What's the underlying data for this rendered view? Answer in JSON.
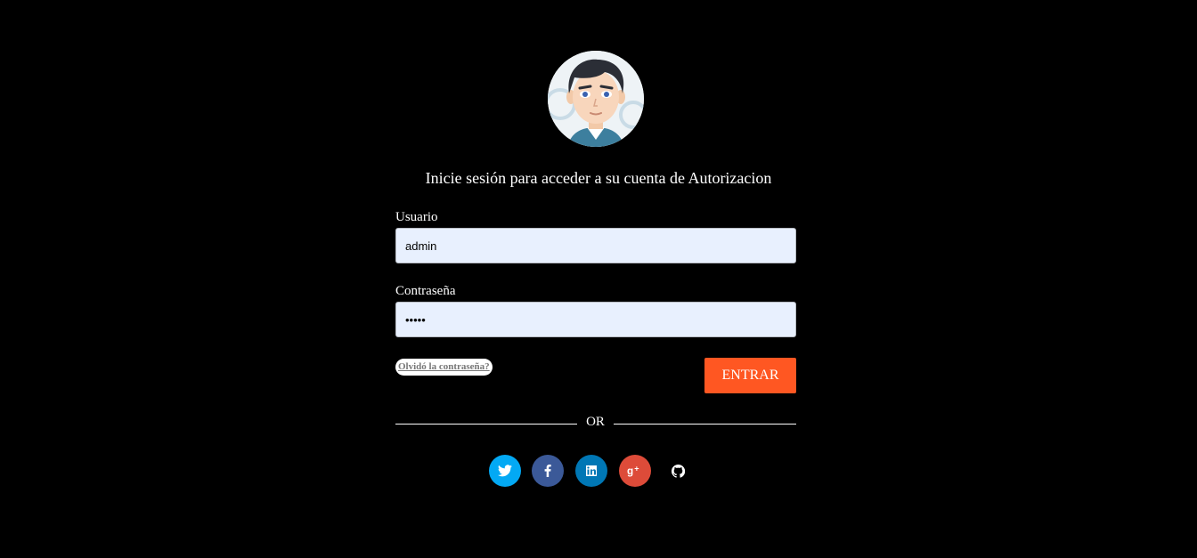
{
  "heading": "Inicie sesión para acceder a su cuenta de Autorizacion",
  "username": {
    "label": "Usuario",
    "value": "admin"
  },
  "password": {
    "label": "Contraseña",
    "value": "•••••"
  },
  "forgot_link": "Olvidó la contraseña?",
  "submit_label": "ENTRAR",
  "divider_text": "OR",
  "colors": {
    "background": "#000000",
    "accent": "#ff5722",
    "input_bg": "#e8f0fe",
    "twitter": "#03a9f4",
    "facebook": "#3b5998",
    "linkedin": "#0077b5",
    "google_plus": "#dd4b39"
  },
  "social": [
    {
      "name": "twitter",
      "icon": "twitter-icon"
    },
    {
      "name": "facebook",
      "icon": "facebook-icon"
    },
    {
      "name": "linkedin",
      "icon": "linkedin-icon"
    },
    {
      "name": "google-plus",
      "icon": "google-plus-icon"
    },
    {
      "name": "github",
      "icon": "github-icon"
    }
  ]
}
